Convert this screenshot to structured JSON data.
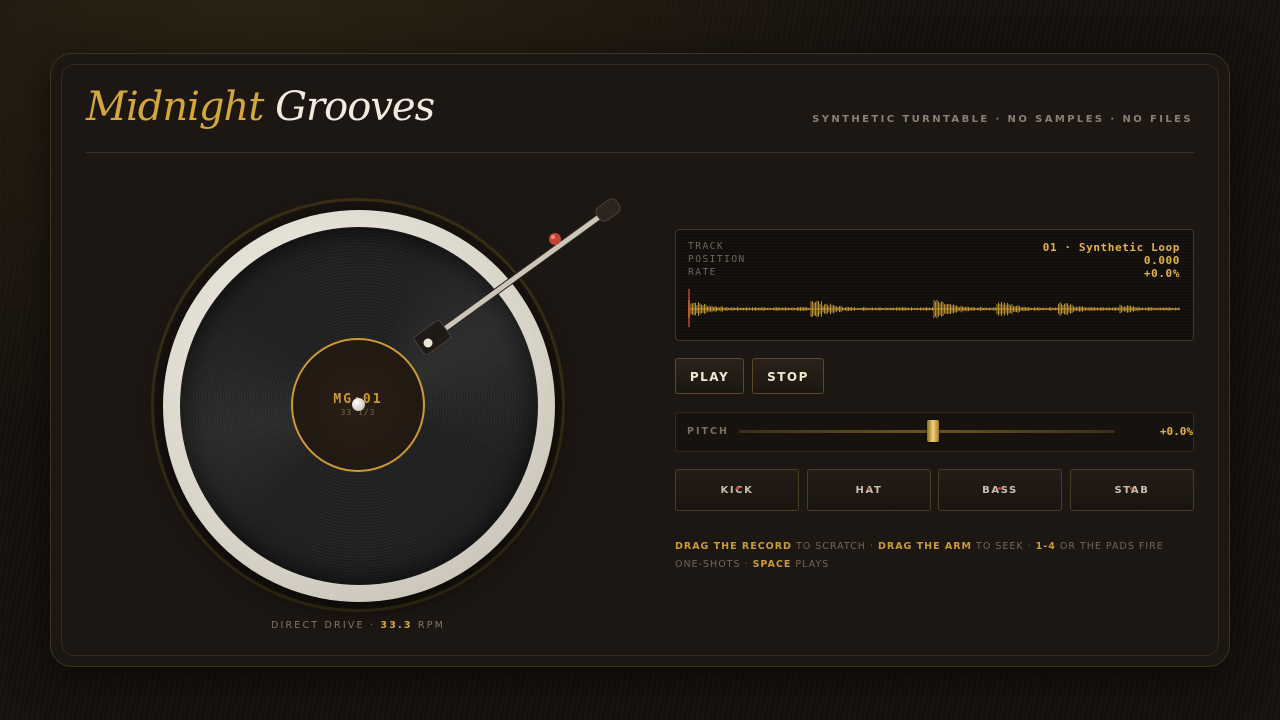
{
  "header": {
    "title_word1": "Midnight",
    "title_word2": "Grooves",
    "subtitle": "SYNTHETIC TURNTABLE · NO SAMPLES · NO FILES"
  },
  "turntable": {
    "record_label_title": "MG·01",
    "record_label_sub": "33 1/3",
    "drive_prefix": "DIRECT DRIVE ·",
    "rpm_value": "33.3",
    "rpm_unit": "RPM"
  },
  "display": {
    "track_key": "TRACK",
    "track_value": "01 · Synthetic Loop",
    "position_key": "POSITION",
    "position_value": "0.000",
    "rate_key": "RATE",
    "rate_value": "+0.0%",
    "playhead_fraction": 0.0
  },
  "transport": {
    "play_label": "PLAY",
    "stop_label": "STOP"
  },
  "pitch": {
    "label": "PITCH",
    "value_text": "+0.0%",
    "level_fraction": 0.5
  },
  "pads": [
    {
      "label": "KICK"
    },
    {
      "label": "HAT"
    },
    {
      "label": "BASS"
    },
    {
      "label": "STAB"
    }
  ],
  "help": {
    "p1": "DRAG THE RECORD",
    "t1": " TO SCRATCH · ",
    "p2": "DRAG THE ARM",
    "t2": " TO SEEK · ",
    "p3": "1-4",
    "t3": " OR THE PADS FIRE ONE-SHOTS · ",
    "p4": "SPACE",
    "t4": " PLAYS"
  },
  "colors": {
    "accent": "#d4a73a",
    "background": "#16110d",
    "panel": "#1d1713",
    "text_light": "#f1ebdd",
    "indicator_red": "#c0443a"
  },
  "icons": {
    "tonearm": "tonearm-icon",
    "spindle": "spindle-icon",
    "waveform": "waveform-icon"
  }
}
